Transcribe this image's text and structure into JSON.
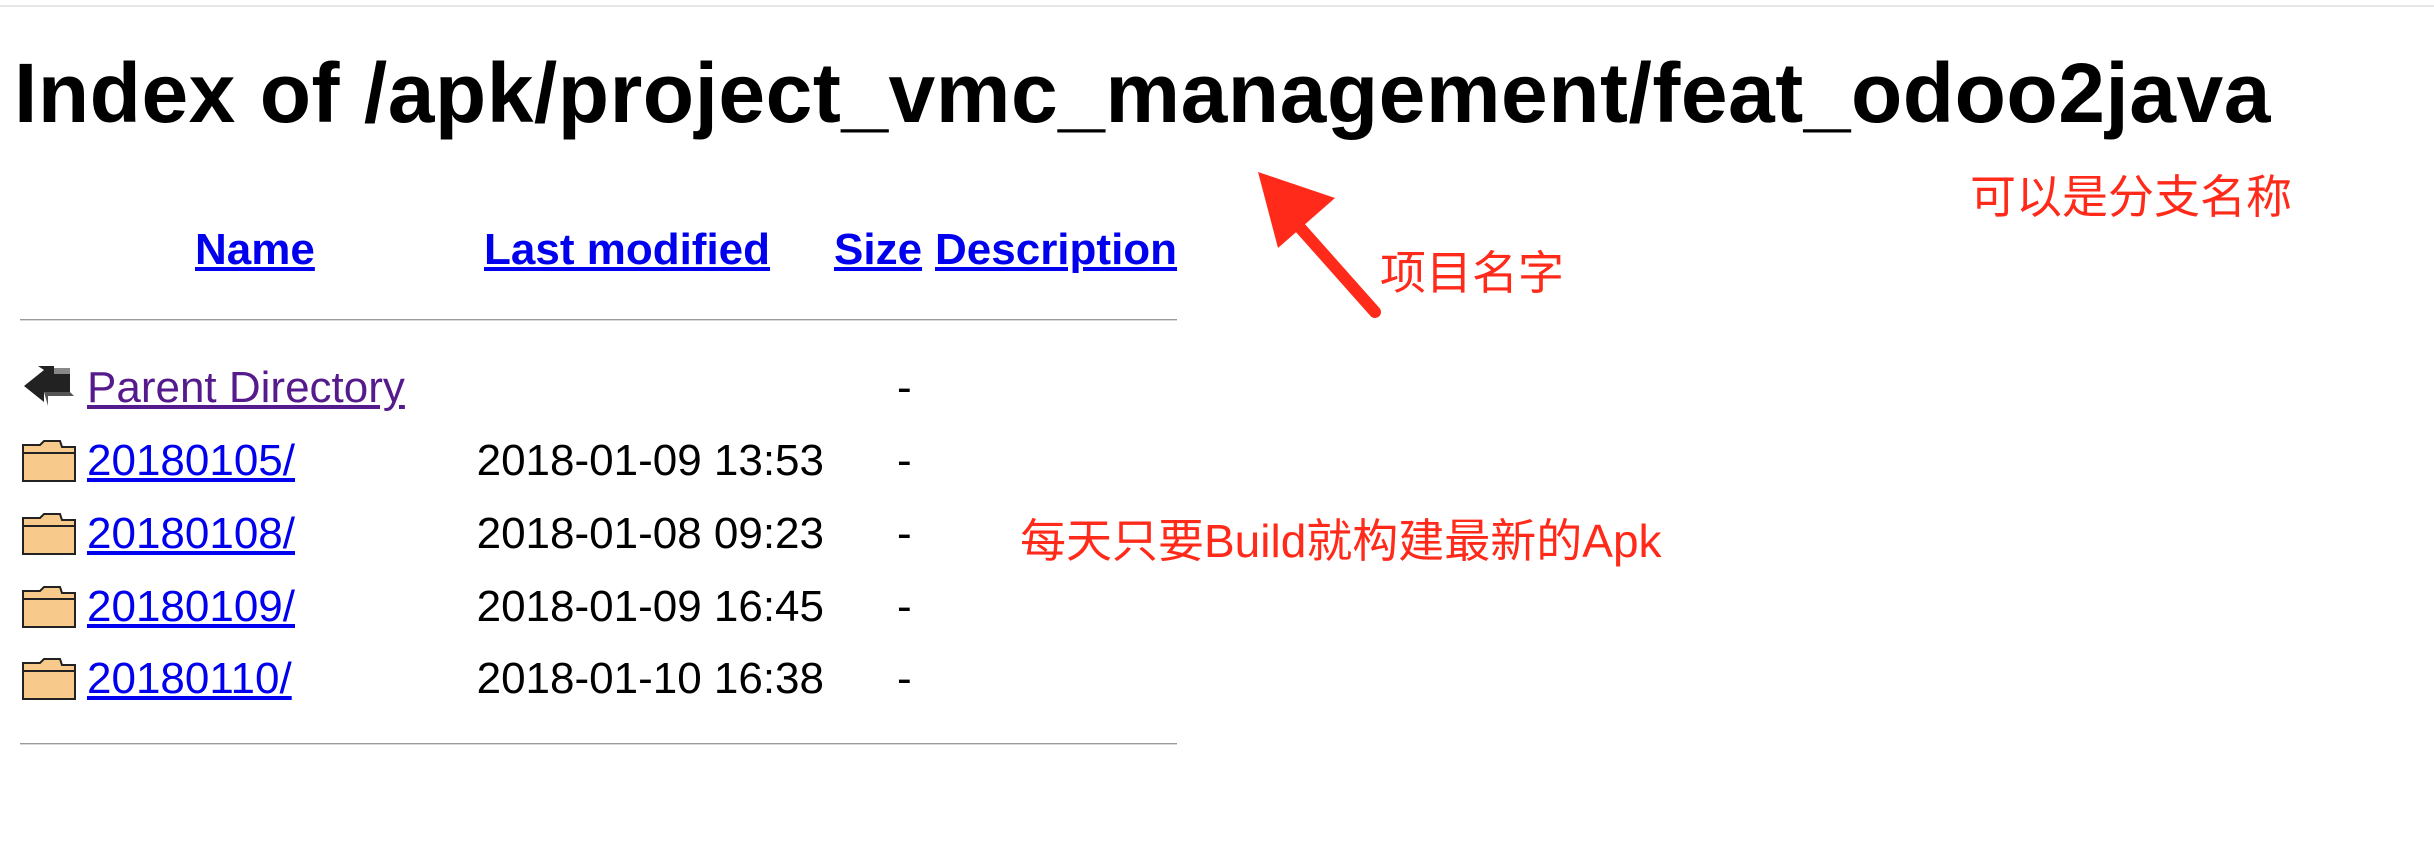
{
  "title": "Index of /apk/project_vmc_management/feat_odoo2java",
  "columns": {
    "name": "Name",
    "last_modified": "Last modified",
    "size": "Size",
    "description": "Description"
  },
  "parent": {
    "name": "Parent Directory",
    "date": "",
    "size": "-",
    "icon": "back-arrow-icon"
  },
  "entries": [
    {
      "name": "20180105/",
      "date": "2018-01-09 13:53",
      "size": "-",
      "icon": "folder-icon"
    },
    {
      "name": "20180108/",
      "date": "2018-01-08 09:23",
      "size": "-",
      "icon": "folder-icon"
    },
    {
      "name": "20180109/",
      "date": "2018-01-09 16:45",
      "size": "-",
      "icon": "folder-icon"
    },
    {
      "name": "20180110/",
      "date": "2018-01-10 16:38",
      "size": "-",
      "icon": "folder-icon"
    }
  ],
  "annotations": {
    "project_name": "项目名字",
    "branch_name": "可以是分支名称",
    "daily_build": "每天只要Build就构建最新的Apk"
  },
  "colors": {
    "link": "#0000ee",
    "visited_link": "#551a8b",
    "annotation": "#ff2a1a",
    "folder_fill": "#f7c98b"
  }
}
